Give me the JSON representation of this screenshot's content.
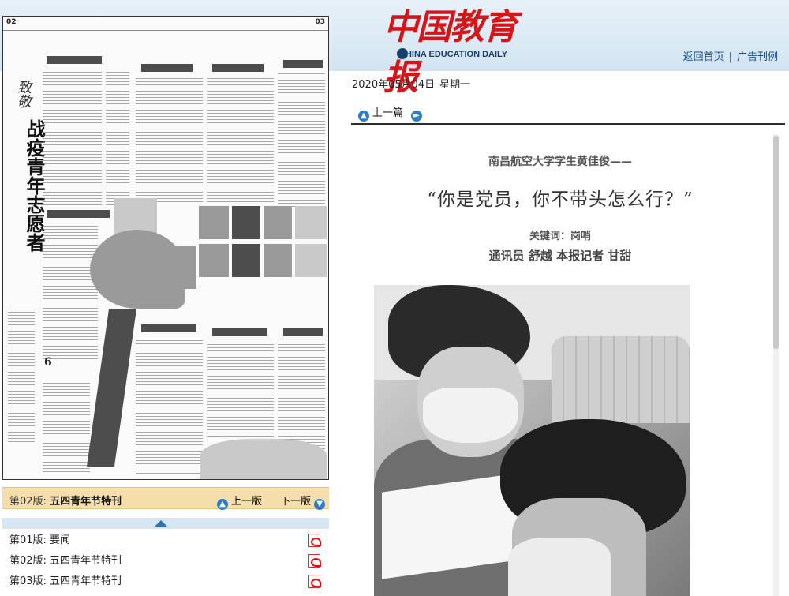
{
  "header": {
    "brand_cn": "中国教育报",
    "brand_en": "CHINA EDUCATION DAILY",
    "link_home": "返回首页",
    "link_sep": "|",
    "link_ads": "广告刊例"
  },
  "scan": {
    "page_left": "02",
    "page_right": "03",
    "vertical_title": "战疫青年志愿者",
    "vertical_sub": "致敬"
  },
  "edition_bar": {
    "label_prefix": "第02版:",
    "label_name": "五四青年节特刊",
    "prev_label": "上一版",
    "next_label": "下一版"
  },
  "edition_list": [
    {
      "label": "第01版: 要闻"
    },
    {
      "label": "第02版: 五四青年节特刊"
    },
    {
      "label": "第03版: 五四青年节特刊"
    }
  ],
  "date": {
    "date": "2020年05月04日",
    "weekday": "星期一"
  },
  "article_nav": {
    "prev_label": "上一篇"
  },
  "article": {
    "kicker": "南昌航空大学学生黄佳俊——",
    "headline": "“你是党员，你不带头怎么行？”",
    "keywords": "关键词：岗哨",
    "byline": "通讯员 舒越 本报记者 甘甜"
  },
  "icons": {
    "nav_circle": "circle-arrow-icon",
    "pdf": "pdf-icon",
    "up_arrow": "triangle-up-icon"
  },
  "colors": {
    "brand_red": "#d4161a",
    "link_blue": "#1a4f8f",
    "edition_bar_bg": "#f6deaa",
    "header_bg": "#d2e4f1"
  }
}
